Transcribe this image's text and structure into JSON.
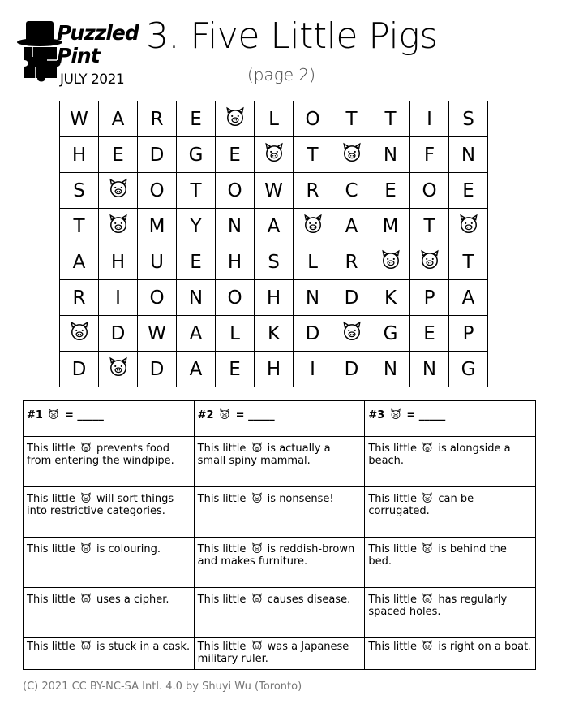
{
  "logo": {
    "line1": "Puzzled",
    "line2": "Pint",
    "date": "JULY 2021"
  },
  "title": "3. Five Little Pigs",
  "subtitle": "(page 2)",
  "grid": [
    [
      "W",
      "A",
      "R",
      "E",
      "🐷",
      "L",
      "O",
      "T",
      "T",
      "I",
      "S"
    ],
    [
      "H",
      "E",
      "D",
      "G",
      "E",
      "🐷",
      "T",
      "🐷",
      "N",
      "F",
      "N"
    ],
    [
      "S",
      "🐷",
      "O",
      "T",
      "O",
      "W",
      "R",
      "C",
      "E",
      "O",
      "E"
    ],
    [
      "T",
      "🐷",
      "M",
      "Y",
      "N",
      "A",
      "🐷",
      "A",
      "M",
      "T",
      "🐷"
    ],
    [
      "A",
      "H",
      "U",
      "E",
      "H",
      "S",
      "L",
      "R",
      "🐷",
      "🐷",
      "T"
    ],
    [
      "R",
      "I",
      "O",
      "N",
      "O",
      "H",
      "N",
      "D",
      "K",
      "P",
      "A"
    ],
    [
      "🐷",
      "D",
      "W",
      "A",
      "L",
      "K",
      "D",
      "🐷",
      "G",
      "E",
      "P"
    ],
    [
      "D",
      "🐷",
      "D",
      "A",
      "E",
      "H",
      "I",
      "D",
      "N",
      "N",
      "G"
    ]
  ],
  "clue_headers": [
    {
      "num": "#1",
      "suffix": "= _____"
    },
    {
      "num": "#2",
      "suffix": "= _____"
    },
    {
      "num": "#3",
      "suffix": "= _____"
    }
  ],
  "clue_prefix": "This little",
  "clues": [
    [
      "prevents food from entering the windpipe.",
      "is actually a small spiny mammal.",
      "is alongside a beach."
    ],
    [
      "will sort things into restrictive categories.",
      "is nonsense!",
      "can be corrugated."
    ],
    [
      "is colouring.",
      "is reddish-brown and makes furniture.",
      "is behind the bed."
    ],
    [
      "uses a cipher.",
      "causes disease.",
      "has regularly spaced holes."
    ],
    [
      "is stuck in a cask.",
      "was a Japanese military ruler.",
      "is right on a boat."
    ]
  ],
  "footer": "(C) 2021 CC BY-NC-SA Intl. 4.0 by Shuyi Wu (Toronto)",
  "pig_symbol": "🐷",
  "pig_icon": "pig-face-icon"
}
